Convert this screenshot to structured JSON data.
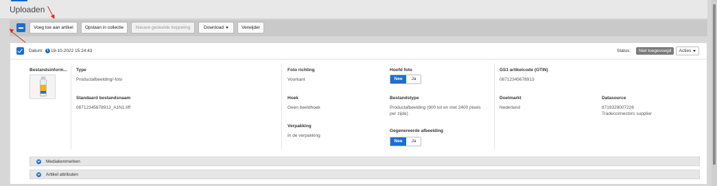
{
  "header": {
    "title": "Uploaden"
  },
  "toolbar": {
    "add_to_article": "Voeg toe aan artikel",
    "save_in_collection": "Opslaan in collectie",
    "new_shared_link": "Nieuwe gedeelde koppeling",
    "download": "Download",
    "delete": "Verwijder"
  },
  "row": {
    "date_label": "Datum:",
    "date_value": "19-10-2022 15:24:43",
    "status_label": "Status:",
    "status_value": "Niet toegevoegd",
    "actions": "Acties",
    "file_info": "Bestandsinform...",
    "fields": {
      "type_label": "Type",
      "type_value": "Productafbeelding/-foto",
      "std_filename_label": "Standaard bestandsnaam",
      "std_filename_value": "08712345678913_A1N1.tiff",
      "photo_direction_label": "Foto richting",
      "photo_direction_value": "Voorkant",
      "angle_label": "Hoek",
      "angle_value": "Geen beeldhoek",
      "packaging_label": "Verpakking",
      "packaging_value": "In de verpakking",
      "main_photo_label": "Hoofd foto",
      "filetype_label": "Bestandstype",
      "filetype_value": "Productafbeelding (900 tot en met 2400 pixels per zijde)",
      "generated_label": "Gegenereerde afbeelding",
      "gtin_label": "GS1 artikelcode (GTIN)",
      "gtin_value": "08712345678913",
      "target_market_label": "Doelmarkt",
      "target_market_value": "Nederland",
      "datasource_label": "Datasource",
      "datasource_value_1": "8719329007226",
      "datasource_value_2": "Tradeconnectors supplier"
    },
    "toggle_no": "Nee",
    "toggle_yes": "Ja"
  },
  "accordions": {
    "media_brands": "Mediakenmerken",
    "article_attributes": "Artikel attributen"
  },
  "colors": {
    "accent": "#1a6fd1",
    "annotation": "#e2231a",
    "status_badge": "#7a7a7a"
  }
}
